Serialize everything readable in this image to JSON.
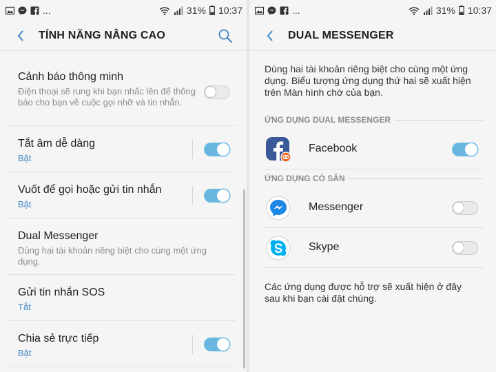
{
  "status_bar": {
    "battery": "31%",
    "time": "10:37",
    "more": "..."
  },
  "left": {
    "title": "TÍNH NĂNG NÂNG CAO",
    "items": [
      {
        "title": "Cảnh báo thông minh",
        "desc": "Điện thoại sẽ rung khi bạn nhấc lên để thông báo cho bạn về cuộc gọi nhỡ và tin nhắn.",
        "status": "",
        "toggle": "off"
      },
      {
        "title": "Tắt âm dễ dàng",
        "desc": "",
        "status": "Bật",
        "toggle": "on"
      },
      {
        "title": "Vuốt để gọi hoặc gửi tin nhắn",
        "desc": "",
        "status": "Bật",
        "toggle": "on"
      },
      {
        "title": "Dual Messenger",
        "desc": "Dùng hai tài khoản riêng biệt cho cùng một ứng dụng.",
        "status": "",
        "toggle": "none"
      },
      {
        "title": "Gửi tin nhắn SOS",
        "desc": "",
        "status": "Tắt",
        "toggle": "none"
      },
      {
        "title": "Chia sẻ trực tiếp",
        "desc": "",
        "status": "Bật",
        "toggle": "on"
      }
    ]
  },
  "right": {
    "title": "DUAL MESSENGER",
    "intro": "Dùng hai tài khoản riêng biệt cho cùng một ứng dụng. Biểu tượng ứng dụng thứ hai sẽ xuất hiện trên Màn hình chờ của bạn.",
    "section1": "ỨNG DỤNG DUAL MESSENGER",
    "section2": "ỨNG DỤNG CÓ SẴN",
    "apps_dual": [
      {
        "name": "Facebook",
        "toggle": "on"
      }
    ],
    "apps_available": [
      {
        "name": "Messenger",
        "toggle": "off"
      },
      {
        "name": "Skype",
        "toggle": "off"
      }
    ],
    "footer": "Các ứng dụng được hỗ trợ sẽ xuất hiện ở đây sau khi bạn cài đặt chúng."
  },
  "colors": {
    "accent": "#3f86c4",
    "toggle_on": "#69b7e0",
    "facebook": "#3b5998",
    "messenger": "#1e88e5",
    "skype": "#00aff0"
  }
}
